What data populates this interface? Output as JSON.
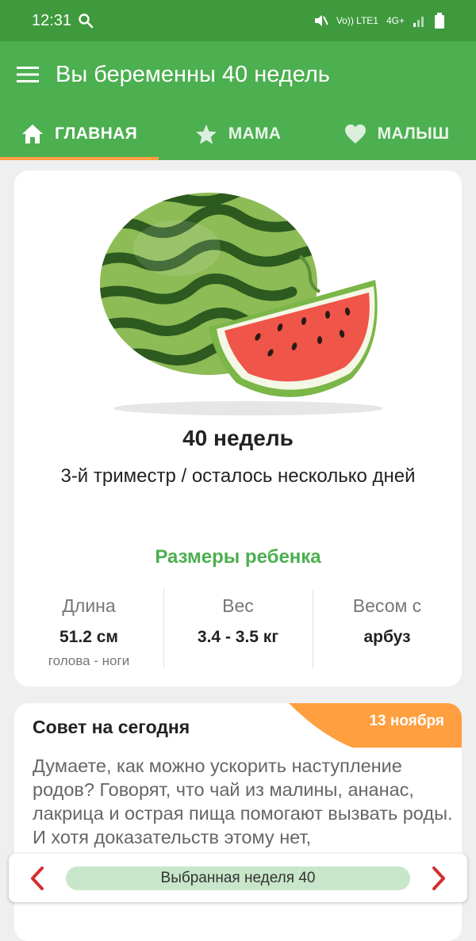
{
  "status": {
    "time": "12:31",
    "network": "4G+",
    "volte": "Vo)) LTE1"
  },
  "app": {
    "title": "Вы беременны 40 недель"
  },
  "tabs": [
    {
      "label": "ГЛАВНАЯ",
      "icon": "home-icon"
    },
    {
      "label": "МАМА",
      "icon": "star-icon"
    },
    {
      "label": "МАЛЫШ",
      "icon": "heart-icon"
    }
  ],
  "week_card": {
    "image": "watermelon-illustration",
    "week": "40 недель",
    "trimester": "3-й триместр / осталось несколько дней",
    "sizes_heading": "Размеры ребенка",
    "stats": [
      {
        "label": "Длина",
        "value": "51.2 см",
        "sub": "голова - ноги"
      },
      {
        "label": "Вес",
        "value": "3.4 - 3.5 кг",
        "sub": ""
      },
      {
        "label": "Весом с",
        "value": "арбуз",
        "sub": ""
      }
    ]
  },
  "tip": {
    "title": "Совет на сегодня",
    "date": "13 ноября",
    "text": "Думаете, как можно ускорить наступление родов? Говорят, что чай из малины, ананас, лакрица и острая пища помогают вызвать роды. И хотя доказательств этому нет,"
  },
  "bottom_nav": {
    "selected_week": "Выбранная неделя 40"
  },
  "colors": {
    "primary": "#4caf50",
    "statusbar": "#3f9a3d",
    "accent": "#ff9f3f",
    "arrow": "#d32f2f",
    "pill": "#c8e6c9"
  }
}
